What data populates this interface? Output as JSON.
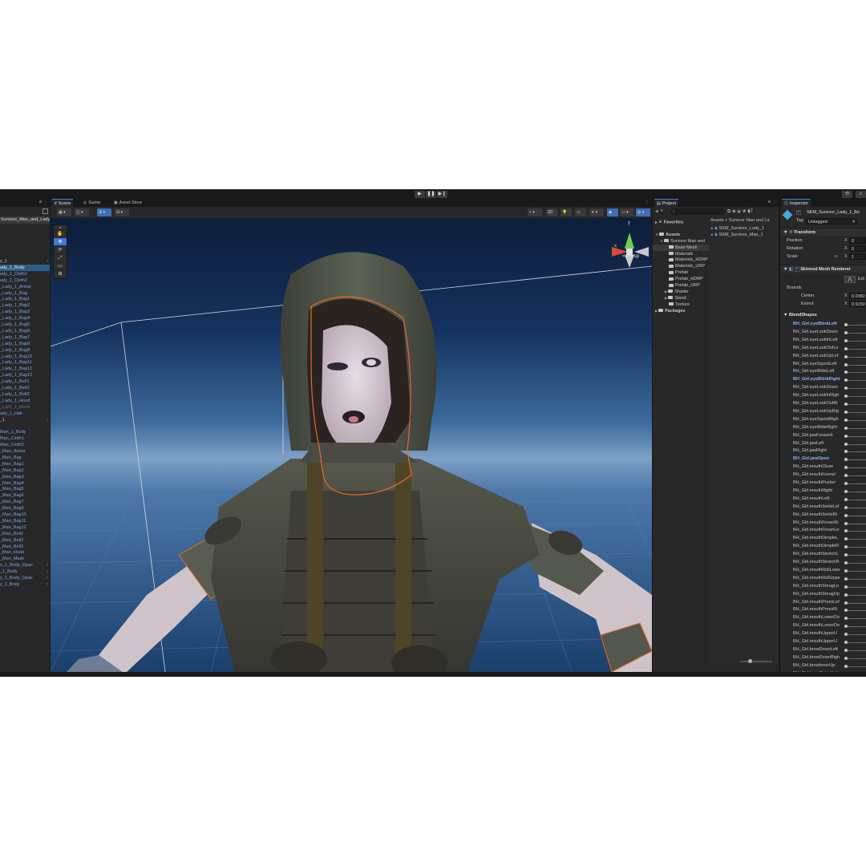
{
  "toolbar": {
    "play": "▶",
    "pause": "❚❚",
    "step": "▶❙",
    "history_icon": "⟲",
    "search_icon": "⌕"
  },
  "hierarchy": {
    "scene_root": "Survivor_Man_and_Lady_",
    "items": [
      {
        "label": "y_1",
        "type": "plain",
        "arrow": true
      },
      {
        "label": "ady_1_Body",
        "type": "sel"
      },
      {
        "label": "ady_1_Cloth1",
        "type": "link"
      },
      {
        "label": "ady_1_Cloth2",
        "type": "link"
      },
      {
        "label": "_Lady_1_Armor",
        "type": "link"
      },
      {
        "label": "_Lady_1_Bag",
        "type": "link"
      },
      {
        "label": "_Lady_1_Bag1",
        "type": "link"
      },
      {
        "label": "_Lady_1_Bag2",
        "type": "link"
      },
      {
        "label": "_Lady_1_Bag3",
        "type": "link"
      },
      {
        "label": "_Lady_1_Bag4",
        "type": "link"
      },
      {
        "label": "_Lady_1_Bag5",
        "type": "link"
      },
      {
        "label": "_Lady_1_Bag6",
        "type": "link"
      },
      {
        "label": "_Lady_1_Bag7",
        "type": "link"
      },
      {
        "label": "_Lady_1_Bag8",
        "type": "link"
      },
      {
        "label": "_Lady_1_Bag9",
        "type": "link"
      },
      {
        "label": "_Lady_1_Bag10",
        "type": "link"
      },
      {
        "label": "_Lady_1_Bag11",
        "type": "link"
      },
      {
        "label": "_Lady_1_Bag12",
        "type": "link"
      },
      {
        "label": "_Lady_1_Bag13",
        "type": "link"
      },
      {
        "label": "_Lady_1_Belt1",
        "type": "link"
      },
      {
        "label": "_Lady_1_Belt2",
        "type": "link"
      },
      {
        "label": "_Lady_1_Belt3",
        "type": "link"
      },
      {
        "label": "_Lady_1_Hood",
        "type": "link"
      },
      {
        "label": "_Lady_1_Mask",
        "type": "dim"
      },
      {
        "label": "ady_1_Hair",
        "type": "link"
      },
      {
        "label": "_1",
        "type": "plain",
        "arrow": true
      },
      {
        "label": "",
        "type": "gap"
      },
      {
        "label": "Man_1_Body",
        "type": "link"
      },
      {
        "label": "Man_Cloth1",
        "type": "link"
      },
      {
        "label": "Man_Cloth2",
        "type": "link"
      },
      {
        "label": "_Man_Armor",
        "type": "link"
      },
      {
        "label": "_Man_Bag",
        "type": "link"
      },
      {
        "label": "_Man_Bag1",
        "type": "link"
      },
      {
        "label": "_Man_Bag2",
        "type": "link"
      },
      {
        "label": "_Man_Bag3",
        "type": "link"
      },
      {
        "label": "_Man_Bag4",
        "type": "link"
      },
      {
        "label": "_Man_Bag5",
        "type": "link"
      },
      {
        "label": "_Man_Bag6",
        "type": "link"
      },
      {
        "label": "_Man_Bag7",
        "type": "link"
      },
      {
        "label": "_Man_Bag8",
        "type": "link"
      },
      {
        "label": "_Man_Bag10",
        "type": "link"
      },
      {
        "label": "_Man_Bag11",
        "type": "link"
      },
      {
        "label": "_Man_Bag12",
        "type": "link"
      },
      {
        "label": "_Man_Belt1",
        "type": "link"
      },
      {
        "label": "_Man_Belt2",
        "type": "link"
      },
      {
        "label": "_Man_Belt3",
        "type": "link"
      },
      {
        "label": "_Man_Hood",
        "type": "link"
      },
      {
        "label": "_Man_Mask",
        "type": "link"
      },
      {
        "label": "n_1_Body_Opac",
        "type": "link",
        "arrow": true
      },
      {
        "label": "_1_Body",
        "type": "link",
        "arrow": true
      },
      {
        "label": "y_1_Body_Opac",
        "type": "link",
        "arrow": true
      },
      {
        "label": "y_1_Body",
        "type": "link",
        "arrow": true
      }
    ]
  },
  "scene": {
    "tabs": [
      {
        "label": "Scene",
        "icon": "#"
      },
      {
        "label": "Game",
        "icon": "◎"
      },
      {
        "label": "Asset Store",
        "icon": "▣"
      }
    ],
    "mode_2d": "2D",
    "persp_label": "< Persp",
    "gizmo_x": "x",
    "gizmo_y": "y"
  },
  "project": {
    "tab": "Project",
    "add_label": "+",
    "search_placeholder": "",
    "tree": [
      {
        "label": "Favorites",
        "indent": 0,
        "bold": true,
        "arrow": "▶"
      },
      {
        "label": "",
        "indent": 0,
        "gap": true
      },
      {
        "label": "Assets",
        "indent": 0,
        "bold": true,
        "arrow": "▼"
      },
      {
        "label": "Survivor Man and",
        "indent": 1,
        "arrow": "▼"
      },
      {
        "label": "Base Mesh",
        "indent": 2,
        "sel": true
      },
      {
        "label": "Materials",
        "indent": 2
      },
      {
        "label": "Materials_HDRP",
        "indent": 2
      },
      {
        "label": "Materials_URP",
        "indent": 2
      },
      {
        "label": "Prefab",
        "indent": 2
      },
      {
        "label": "Prefab_HDRP",
        "indent": 2
      },
      {
        "label": "Prefab_URP",
        "indent": 2
      },
      {
        "label": "Shader",
        "indent": 2,
        "arrow": "▶"
      },
      {
        "label": "Stand",
        "indent": 2,
        "arrow": "▶"
      },
      {
        "label": "Texture",
        "indent": 2
      },
      {
        "label": "Packages",
        "indent": 0,
        "bold": true,
        "arrow": "▶"
      }
    ],
    "breadcrumb": "Assets > Survivor Man and La",
    "files": [
      "SKM_Survivor_Lady_1",
      "SKM_Survivor_Man_1"
    ]
  },
  "inspector": {
    "tab": "Inspector",
    "object_name": "SKM_Survivor_Lady_1_Bo",
    "tag_label": "Tag",
    "tag_value": "Untagged",
    "transform": {
      "title": "Transform",
      "position_label": "Position",
      "rotation_label": "Rotation",
      "scale_label": "Scale",
      "position_x": "0",
      "rotation_x": "0",
      "scale_x": "1"
    },
    "renderer": {
      "title": "Skinned Mesh Renderer",
      "edit_label": "Edi",
      "bounds_label": "Bounds",
      "center_label": "Center",
      "extent_label": "Extent",
      "center_x": "0.0382",
      "extent_x": "0.9150"
    },
    "blendshapes_title": "BlendShapes",
    "blendshapes": [
      {
        "label": "BH_Girl.eyeBlinkLeft",
        "hdr": true
      },
      {
        "label": "BH_Girl.eyeLookDown"
      },
      {
        "label": "BH_Girl.eyeLookInLeft"
      },
      {
        "label": "BH_Girl.eyeLookOutLe"
      },
      {
        "label": "BH_Girl.eyeLookUpLef"
      },
      {
        "label": "BH_Girl.eyeSquintLeft"
      },
      {
        "label": "BH_Girl.eyeWideLeft"
      },
      {
        "label": "BH_Girl.eyeBlinkRight",
        "hdr": true
      },
      {
        "label": "BH_Girl.eyeLookDown"
      },
      {
        "label": "BH_Girl.eyeLookInRigh"
      },
      {
        "label": "BH_Girl.eyeLookOutRi"
      },
      {
        "label": "BH_Girl.eyeLookUpRig"
      },
      {
        "label": "BH_Girl.eyeSquintRigh"
      },
      {
        "label": "BH_Girl.eyeWideRight"
      },
      {
        "label": "BH_Girl.jawForward"
      },
      {
        "label": "BH_Girl.jawLeft"
      },
      {
        "label": "BH_Girl.jawRight"
      },
      {
        "label": "BH_Girl.jawOpen",
        "hdr": true
      },
      {
        "label": "BH_Girl.mouthClose"
      },
      {
        "label": "BH_Girl.mouthFunnel"
      },
      {
        "label": "BH_Girl.mouthPucker"
      },
      {
        "label": "BH_Girl.mouthRight"
      },
      {
        "label": "BH_Girl.mouthLeft"
      },
      {
        "label": "BH_Girl.mouthSmileLef"
      },
      {
        "label": "BH_Girl.mouthSmileRi"
      },
      {
        "label": "BH_Girl.mouthFrownRi"
      },
      {
        "label": "BH_Girl.mouthFrownLe"
      },
      {
        "label": "BH_Girl.mouthDimpleL"
      },
      {
        "label": "BH_Girl.mouthDimpleR"
      },
      {
        "label": "BH_Girl.mouthStretchL"
      },
      {
        "label": "BH_Girl.mouthStretchR"
      },
      {
        "label": "BH_Girl.mouthRollLowe"
      },
      {
        "label": "BH_Girl.mouthRollUppe"
      },
      {
        "label": "BH_Girl.mouthShrugLo"
      },
      {
        "label": "BH_Girl.mouthShrugUp"
      },
      {
        "label": "BH_Girl.mouthPressLef"
      },
      {
        "label": "BH_Girl.mouthPressRi"
      },
      {
        "label": "BH_Girl.mouthLowerDo"
      },
      {
        "label": "BH_Girl.mouthLowerDo"
      },
      {
        "label": "BH_Girl.mouthUpperU"
      },
      {
        "label": "BH_Girl.mouthUpperU"
      },
      {
        "label": "BH_Girl.browDownLeft"
      },
      {
        "label": "BH_Girl.browDownRigh"
      },
      {
        "label": "BH_Girl.browInnerUp"
      },
      {
        "label": "BH_Girl.browOuterUpL"
      }
    ]
  }
}
